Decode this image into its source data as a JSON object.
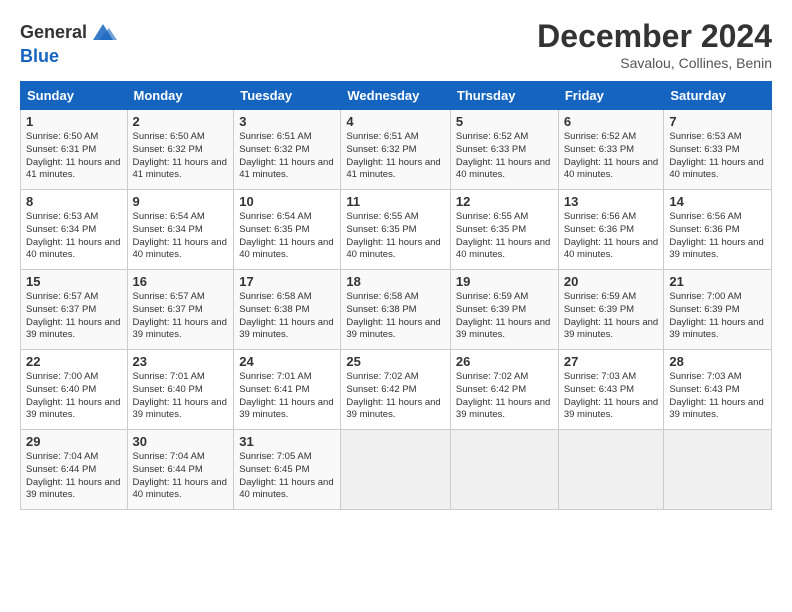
{
  "header": {
    "logo_line1": "General",
    "logo_line2": "Blue",
    "month": "December 2024",
    "location": "Savalou, Collines, Benin"
  },
  "days_of_week": [
    "Sunday",
    "Monday",
    "Tuesday",
    "Wednesday",
    "Thursday",
    "Friday",
    "Saturday"
  ],
  "weeks": [
    [
      {
        "day": "1",
        "sunrise": "6:50 AM",
        "sunset": "6:31 PM",
        "daylight": "11 hours and 41 minutes."
      },
      {
        "day": "2",
        "sunrise": "6:50 AM",
        "sunset": "6:32 PM",
        "daylight": "11 hours and 41 minutes."
      },
      {
        "day": "3",
        "sunrise": "6:51 AM",
        "sunset": "6:32 PM",
        "daylight": "11 hours and 41 minutes."
      },
      {
        "day": "4",
        "sunrise": "6:51 AM",
        "sunset": "6:32 PM",
        "daylight": "11 hours and 41 minutes."
      },
      {
        "day": "5",
        "sunrise": "6:52 AM",
        "sunset": "6:33 PM",
        "daylight": "11 hours and 40 minutes."
      },
      {
        "day": "6",
        "sunrise": "6:52 AM",
        "sunset": "6:33 PM",
        "daylight": "11 hours and 40 minutes."
      },
      {
        "day": "7",
        "sunrise": "6:53 AM",
        "sunset": "6:33 PM",
        "daylight": "11 hours and 40 minutes."
      }
    ],
    [
      {
        "day": "8",
        "sunrise": "6:53 AM",
        "sunset": "6:34 PM",
        "daylight": "11 hours and 40 minutes."
      },
      {
        "day": "9",
        "sunrise": "6:54 AM",
        "sunset": "6:34 PM",
        "daylight": "11 hours and 40 minutes."
      },
      {
        "day": "10",
        "sunrise": "6:54 AM",
        "sunset": "6:35 PM",
        "daylight": "11 hours and 40 minutes."
      },
      {
        "day": "11",
        "sunrise": "6:55 AM",
        "sunset": "6:35 PM",
        "daylight": "11 hours and 40 minutes."
      },
      {
        "day": "12",
        "sunrise": "6:55 AM",
        "sunset": "6:35 PM",
        "daylight": "11 hours and 40 minutes."
      },
      {
        "day": "13",
        "sunrise": "6:56 AM",
        "sunset": "6:36 PM",
        "daylight": "11 hours and 40 minutes."
      },
      {
        "day": "14",
        "sunrise": "6:56 AM",
        "sunset": "6:36 PM",
        "daylight": "11 hours and 39 minutes."
      }
    ],
    [
      {
        "day": "15",
        "sunrise": "6:57 AM",
        "sunset": "6:37 PM",
        "daylight": "11 hours and 39 minutes."
      },
      {
        "day": "16",
        "sunrise": "6:57 AM",
        "sunset": "6:37 PM",
        "daylight": "11 hours and 39 minutes."
      },
      {
        "day": "17",
        "sunrise": "6:58 AM",
        "sunset": "6:38 PM",
        "daylight": "11 hours and 39 minutes."
      },
      {
        "day": "18",
        "sunrise": "6:58 AM",
        "sunset": "6:38 PM",
        "daylight": "11 hours and 39 minutes."
      },
      {
        "day": "19",
        "sunrise": "6:59 AM",
        "sunset": "6:39 PM",
        "daylight": "11 hours and 39 minutes."
      },
      {
        "day": "20",
        "sunrise": "6:59 AM",
        "sunset": "6:39 PM",
        "daylight": "11 hours and 39 minutes."
      },
      {
        "day": "21",
        "sunrise": "7:00 AM",
        "sunset": "6:39 PM",
        "daylight": "11 hours and 39 minutes."
      }
    ],
    [
      {
        "day": "22",
        "sunrise": "7:00 AM",
        "sunset": "6:40 PM",
        "daylight": "11 hours and 39 minutes."
      },
      {
        "day": "23",
        "sunrise": "7:01 AM",
        "sunset": "6:40 PM",
        "daylight": "11 hours and 39 minutes."
      },
      {
        "day": "24",
        "sunrise": "7:01 AM",
        "sunset": "6:41 PM",
        "daylight": "11 hours and 39 minutes."
      },
      {
        "day": "25",
        "sunrise": "7:02 AM",
        "sunset": "6:42 PM",
        "daylight": "11 hours and 39 minutes."
      },
      {
        "day": "26",
        "sunrise": "7:02 AM",
        "sunset": "6:42 PM",
        "daylight": "11 hours and 39 minutes."
      },
      {
        "day": "27",
        "sunrise": "7:03 AM",
        "sunset": "6:43 PM",
        "daylight": "11 hours and 39 minutes."
      },
      {
        "day": "28",
        "sunrise": "7:03 AM",
        "sunset": "6:43 PM",
        "daylight": "11 hours and 39 minutes."
      }
    ],
    [
      {
        "day": "29",
        "sunrise": "7:04 AM",
        "sunset": "6:44 PM",
        "daylight": "11 hours and 39 minutes."
      },
      {
        "day": "30",
        "sunrise": "7:04 AM",
        "sunset": "6:44 PM",
        "daylight": "11 hours and 40 minutes."
      },
      {
        "day": "31",
        "sunrise": "7:05 AM",
        "sunset": "6:45 PM",
        "daylight": "11 hours and 40 minutes."
      },
      null,
      null,
      null,
      null
    ]
  ]
}
